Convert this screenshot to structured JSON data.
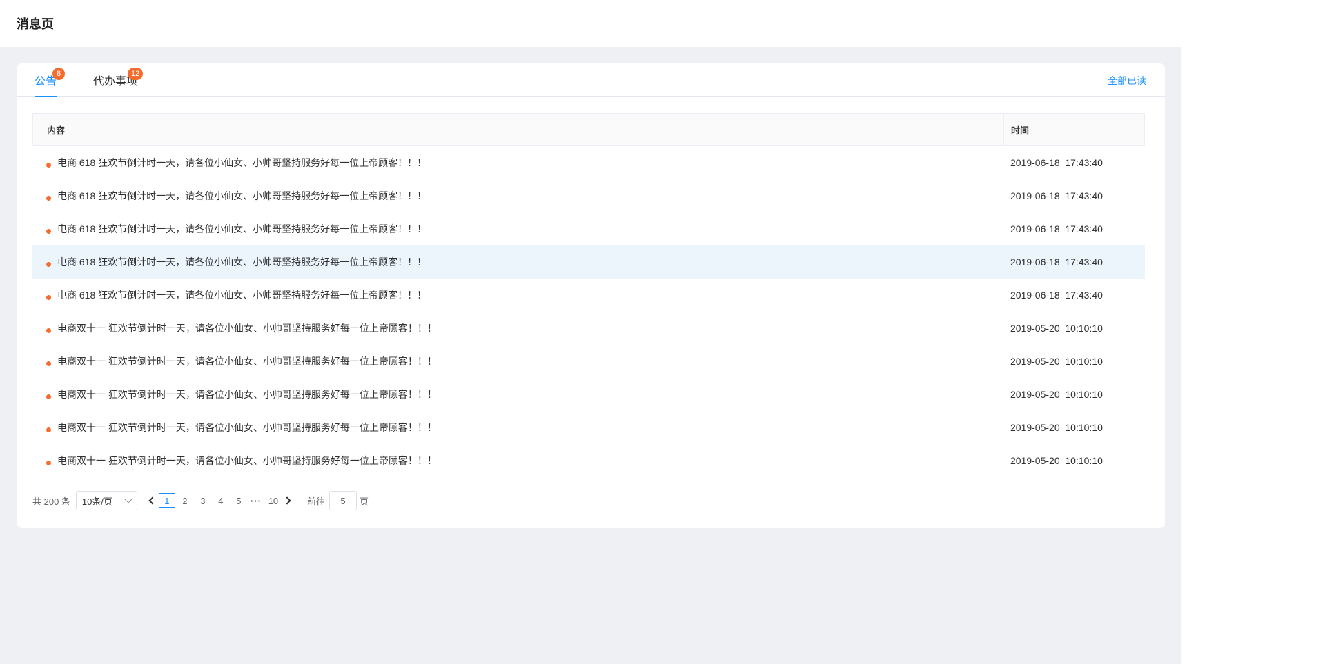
{
  "header": {
    "title": "消息页"
  },
  "tabs": [
    {
      "label": "公告",
      "badge": "8",
      "active": true
    },
    {
      "label": "代办事项",
      "badge": "12",
      "active": false
    }
  ],
  "mark_all_read": "全部已读",
  "table": {
    "columns": {
      "content": "内容",
      "time": "时间"
    },
    "rows": [
      {
        "content": "电商 618 狂欢节倒计时一天，请各位小仙女、小帅哥坚持服务好每一位上帝顾客！！！",
        "time": "2019-06-18  17:43:40"
      },
      {
        "content": "电商 618 狂欢节倒计时一天，请各位小仙女、小帅哥坚持服务好每一位上帝顾客！！！",
        "time": "2019-06-18  17:43:40"
      },
      {
        "content": "电商 618 狂欢节倒计时一天，请各位小仙女、小帅哥坚持服务好每一位上帝顾客！！！",
        "time": "2019-06-18  17:43:40"
      },
      {
        "content": "电商 618 狂欢节倒计时一天，请各位小仙女、小帅哥坚持服务好每一位上帝顾客！！！",
        "time": "2019-06-18  17:43:40"
      },
      {
        "content": "电商 618 狂欢节倒计时一天，请各位小仙女、小帅哥坚持服务好每一位上帝顾客！！！",
        "time": "2019-06-18  17:43:40"
      },
      {
        "content": "电商双十一 狂欢节倒计时一天，请各位小仙女、小帅哥坚持服务好每一位上帝顾客！！！",
        "time": "2019-05-20  10:10:10"
      },
      {
        "content": "电商双十一 狂欢节倒计时一天，请各位小仙女、小帅哥坚持服务好每一位上帝顾客！！！",
        "time": "2019-05-20  10:10:10"
      },
      {
        "content": "电商双十一 狂欢节倒计时一天，请各位小仙女、小帅哥坚持服务好每一位上帝顾客！！！",
        "time": "2019-05-20  10:10:10"
      },
      {
        "content": "电商双十一 狂欢节倒计时一天，请各位小仙女、小帅哥坚持服务好每一位上帝顾客！！！",
        "time": "2019-05-20  10:10:10"
      },
      {
        "content": "电商双十一 狂欢节倒计时一天，请各位小仙女、小帅哥坚持服务好每一位上帝顾客！！！",
        "time": "2019-05-20  10:10:10"
      }
    ]
  },
  "pagination": {
    "total": "共 200 条",
    "page_size": "10条/页",
    "pages": [
      "1",
      "2",
      "3",
      "4",
      "5"
    ],
    "ellipsis": "···",
    "last_page": "10",
    "current": "1",
    "jump_label": "前往",
    "jump_value": "5",
    "jump_suffix": "页"
  },
  "colors": {
    "accent": "#1890ff",
    "badge": "#f56c2c",
    "hover_row": "#ecf4fc"
  }
}
